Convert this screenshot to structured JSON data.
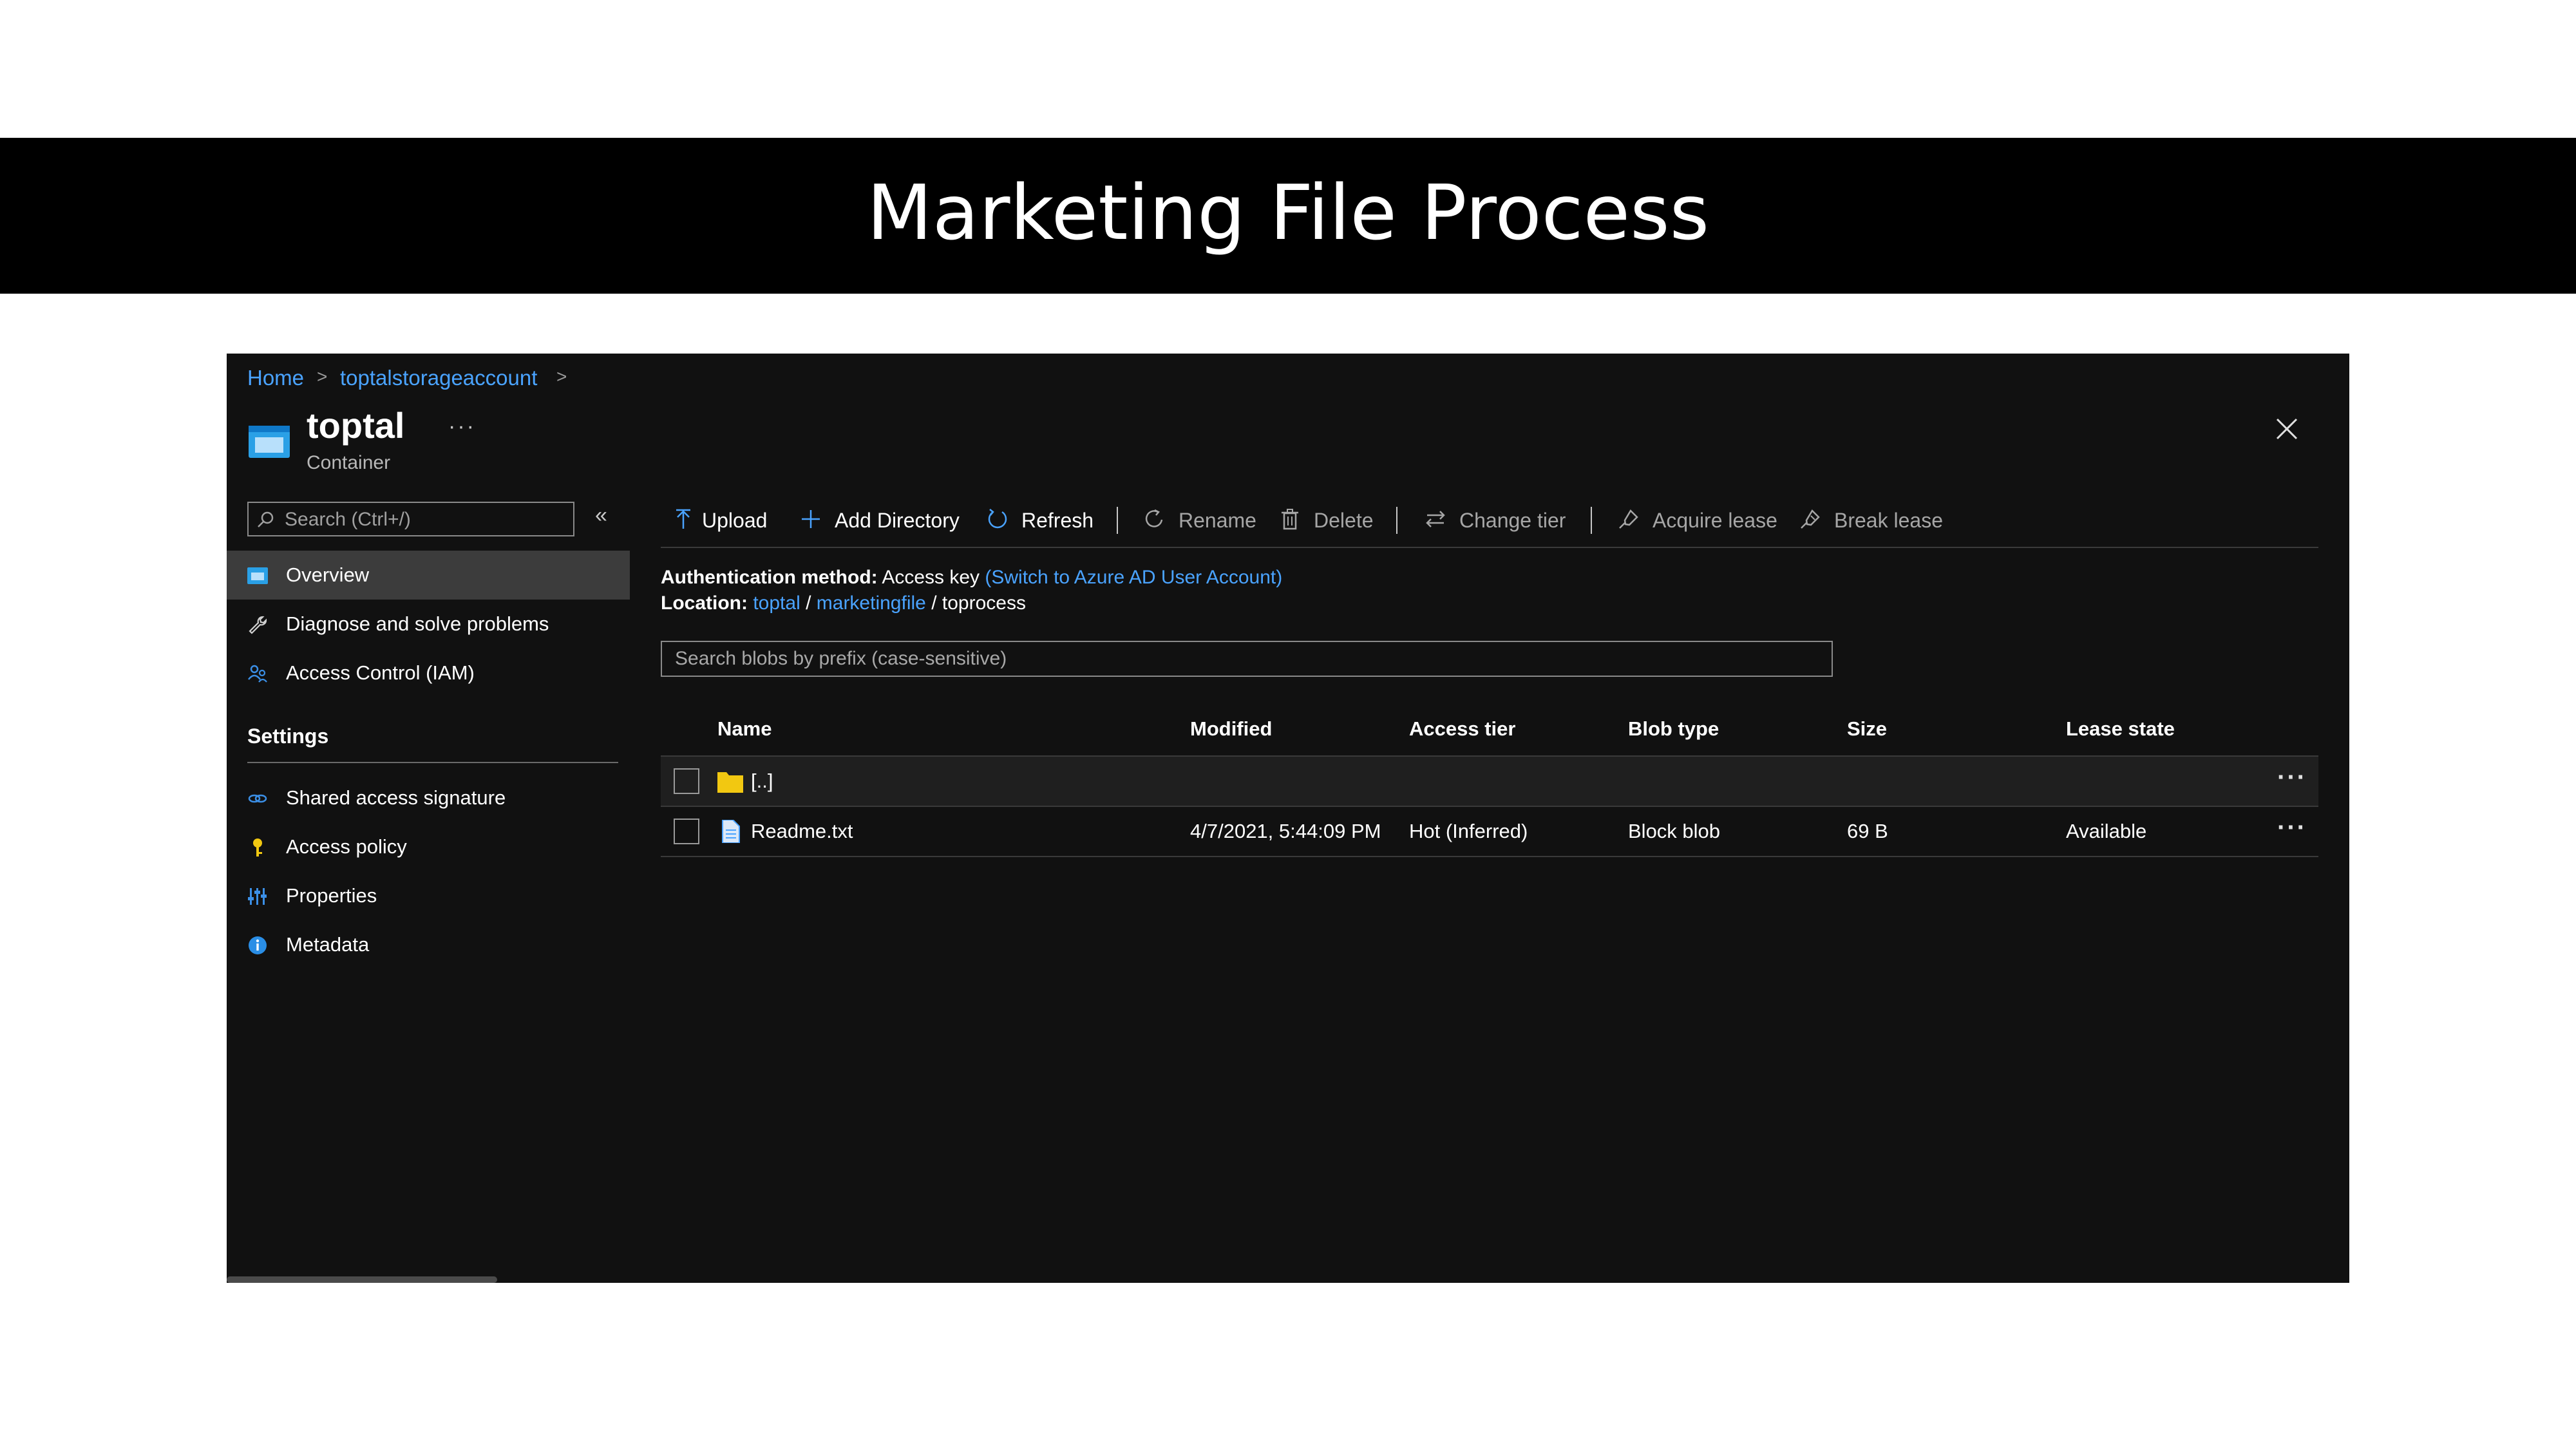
{
  "slide": {
    "title": "Marketing File Process"
  },
  "breadcrumb": {
    "items": [
      "Home",
      "toptalstorageaccount"
    ],
    "separator": ">"
  },
  "header": {
    "name": "toptal",
    "type": "Container",
    "more": "···"
  },
  "sidebar": {
    "search_placeholder": "Search (Ctrl+/)",
    "collapse": "«",
    "items": [
      {
        "label": "Overview",
        "icon": "container-icon",
        "active": true
      },
      {
        "label": "Diagnose and solve problems",
        "icon": "wrench-icon"
      },
      {
        "label": "Access Control (IAM)",
        "icon": "people-icon"
      }
    ],
    "settings_title": "Settings",
    "settings_items": [
      {
        "label": "Shared access signature",
        "icon": "link-icon"
      },
      {
        "label": "Access policy",
        "icon": "key-icon"
      },
      {
        "label": "Properties",
        "icon": "sliders-icon"
      },
      {
        "label": "Metadata",
        "icon": "info-icon"
      }
    ]
  },
  "toolbar": {
    "upload": "Upload",
    "add_directory": "Add Directory",
    "refresh": "Refresh",
    "rename": "Rename",
    "delete": "Delete",
    "change_tier": "Change tier",
    "acquire_lease": "Acquire lease",
    "break_lease": "Break lease"
  },
  "info": {
    "auth_label": "Authentication method:",
    "auth_value": "Access key",
    "auth_switch": "(Switch to Azure AD User Account)",
    "location_label": "Location:",
    "location_path": [
      "toptal",
      "marketingfile",
      "toprocess"
    ],
    "path_separator": "/"
  },
  "blob_search": {
    "placeholder": "Search blobs by prefix (case-sensitive)"
  },
  "table": {
    "columns": [
      "Name",
      "Modified",
      "Access tier",
      "Blob type",
      "Size",
      "Lease state"
    ],
    "rows": [
      {
        "name": "[..]",
        "modified": "",
        "access_tier": "",
        "blob_type": "",
        "size": "",
        "lease_state": "",
        "icon": "folder-icon"
      },
      {
        "name": "Readme.txt",
        "modified": "4/7/2021, 5:44:09 PM",
        "access_tier": "Hot (Inferred)",
        "blob_type": "Block blob",
        "size": "69 B",
        "lease_state": "Available",
        "icon": "file-icon"
      }
    ],
    "row_menu": "···"
  },
  "colors": {
    "accent": "#4aa3ff",
    "folder": "#f2c811",
    "key": "#f2c811",
    "background": "#111111"
  }
}
